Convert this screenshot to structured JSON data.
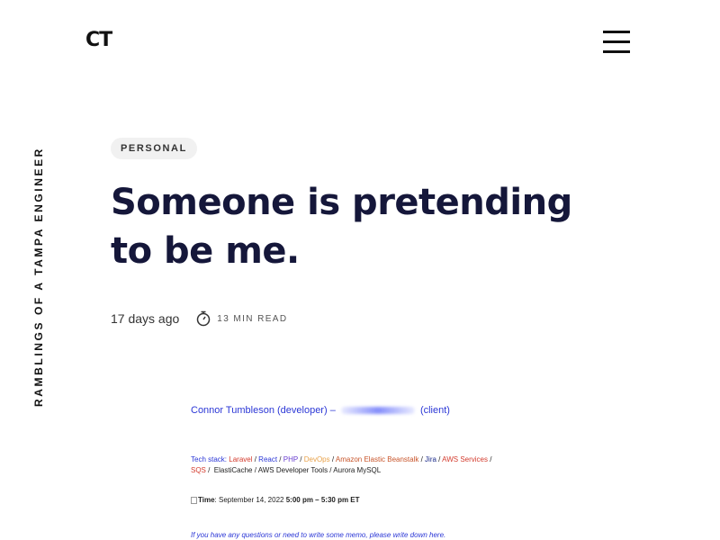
{
  "header": {
    "logo": "CT",
    "menu_icon": "hamburger-menu-icon"
  },
  "sidebar": {
    "tagline": "RAMBLINGS OF A TAMPA ENGINEER"
  },
  "article": {
    "category": "PERSONAL",
    "title": "Someone is pretending to be me.",
    "date": "17 days ago",
    "timer_icon": "stopwatch-icon",
    "read_time": "13 MIN READ"
  },
  "embedded_image": {
    "heading_left": "Connor Tumbleson (developer) –",
    "heading_right": "(client)",
    "tech_label": "Tech stack:",
    "tech": {
      "laravel": "Laravel",
      "react": "React",
      "php": "PHP",
      "devops": "DevOps",
      "beanstalk": "Amazon Elastic Beanstalk",
      "jira": "Jira",
      "aws": "AWS Services",
      "sqs": "SQS",
      "rest": "ElastiCache / AWS Developer Tools / Aurora MySQL"
    },
    "time_label": "Time",
    "time_date": ": September 14, 2022",
    "time_range": "5:00 pm – 5:30 pm ET",
    "note": "If you have any questions or need to write some memo, please write down here."
  },
  "colors": {
    "title": "#15173a",
    "link_blue": "#2b37d6",
    "tag_bg": "#f1f1f1"
  }
}
